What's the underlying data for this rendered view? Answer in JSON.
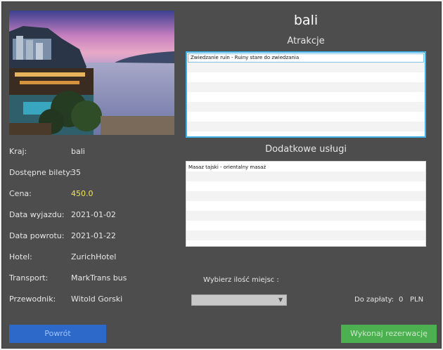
{
  "destination": {
    "title": "bali"
  },
  "details": [
    {
      "label": "Kraj:",
      "value": "bali"
    },
    {
      "label": "Dostępne bilety:",
      "value": "35"
    },
    {
      "label": "Cena:",
      "value": "450.0"
    },
    {
      "label": "Data wyjazdu:",
      "value": "2021-01-02"
    },
    {
      "label": "Data powrotu:",
      "value": "2021-01-22"
    },
    {
      "label": "Hotel:",
      "value": "ZurichHotel"
    },
    {
      "label": "Transport:",
      "value": "MarkTrans bus"
    },
    {
      "label": "Przewodnik:",
      "value": "Witold Gorski"
    }
  ],
  "attractions": {
    "title": "Atrakcje",
    "items": [
      "Zwiedzanie ruin - Ruiny stare do zwiedzania"
    ]
  },
  "services": {
    "title": "Dodatkowe usługi",
    "items": [
      "Masaz tajski - orientalny masaż"
    ]
  },
  "seats": {
    "label": "Wybierz ilość miejsc :",
    "selected": ""
  },
  "payment": {
    "label": "Do zapłaty:",
    "amount": "0",
    "currency": "PLN"
  },
  "buttons": {
    "back": "Powrót",
    "book": "Wykonaj rezerwację"
  },
  "colors": {
    "background": "#4d4d4d",
    "price": "#f1e65a",
    "back_button": "#2d69c9",
    "book_button": "#4caf50",
    "focus": "#3fb1e6"
  }
}
